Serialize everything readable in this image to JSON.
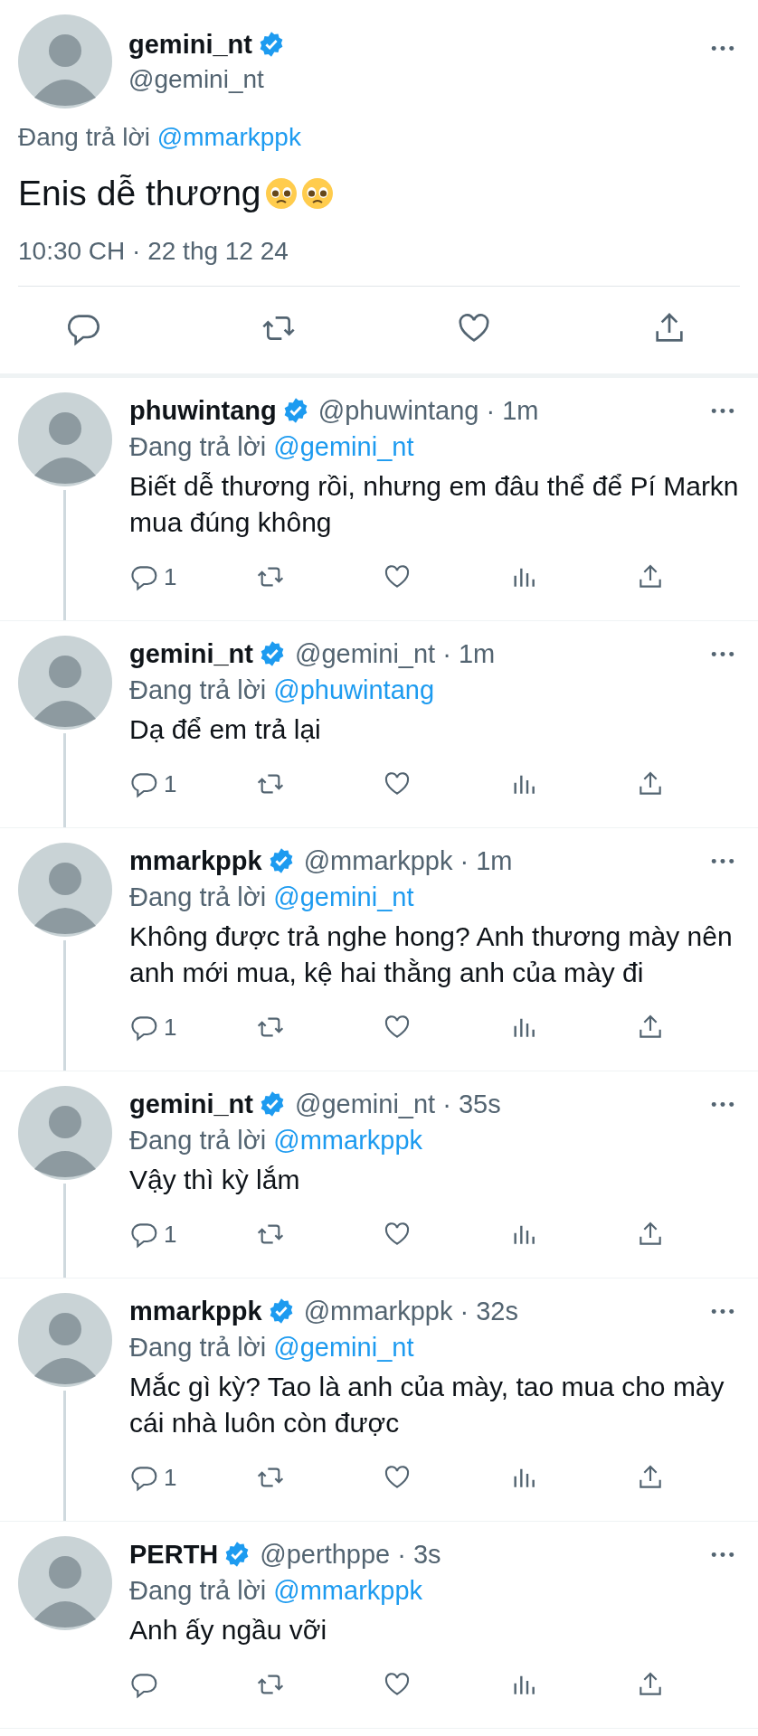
{
  "main_tweet": {
    "name": "gemini_nt",
    "verified": true,
    "handle": "@gemini_nt",
    "reply_prefix": "Đang trả lời",
    "reply_to": "@mmarkppk",
    "body": "Enis dễ thương",
    "timestamp": "10:30 CH · 22 thg 12 24"
  },
  "replies": [
    {
      "name": "phuwintang",
      "verified": true,
      "handle": "@phuwintang · 1m",
      "reply_prefix": "Đang trả lời",
      "reply_to": "@gemini_nt",
      "body": "Biết dễ thương rồi, nhưng em đâu thể để Pí Markn mua đúng không",
      "reply_count": "1",
      "thread_continues": true
    },
    {
      "name": "gemini_nt",
      "verified": true,
      "handle": "@gemini_nt · 1m",
      "reply_prefix": "Đang trả lời",
      "reply_to": "@phuwintang",
      "body": "Dạ để em trả lại",
      "reply_count": "1",
      "thread_continues": true
    },
    {
      "name": "mmarkppk",
      "verified": true,
      "handle": "@mmarkppk · 1m",
      "reply_prefix": "Đang trả lời",
      "reply_to": "@gemini_nt",
      "body": "Không được trả nghe hong? Anh thương mày nên anh mới mua, kệ hai thằng anh của mày đi",
      "reply_count": "1",
      "thread_continues": true
    },
    {
      "name": "gemini_nt",
      "verified": true,
      "handle": "@gemini_nt · 35s",
      "reply_prefix": "Đang trả lời",
      "reply_to": "@mmarkppk",
      "body": "Vậy thì kỳ lắm",
      "reply_count": "1",
      "thread_continues": true
    },
    {
      "name": "mmarkppk",
      "verified": true,
      "handle": "@mmarkppk · 32s",
      "reply_prefix": "Đang trả lời",
      "reply_to": "@gemini_nt",
      "body": "Mắc gì kỳ? Tao là anh của mày, tao mua cho mày cái nhà luôn còn được",
      "reply_count": "1",
      "thread_continues": true
    },
    {
      "name": "PERTH",
      "verified": true,
      "handle": "@perthppe · 3s",
      "reply_prefix": "Đang trả lời",
      "reply_to": "@mmarkppk",
      "body": "Anh ấy ngầu vỡi",
      "thread_continues": false
    }
  ]
}
